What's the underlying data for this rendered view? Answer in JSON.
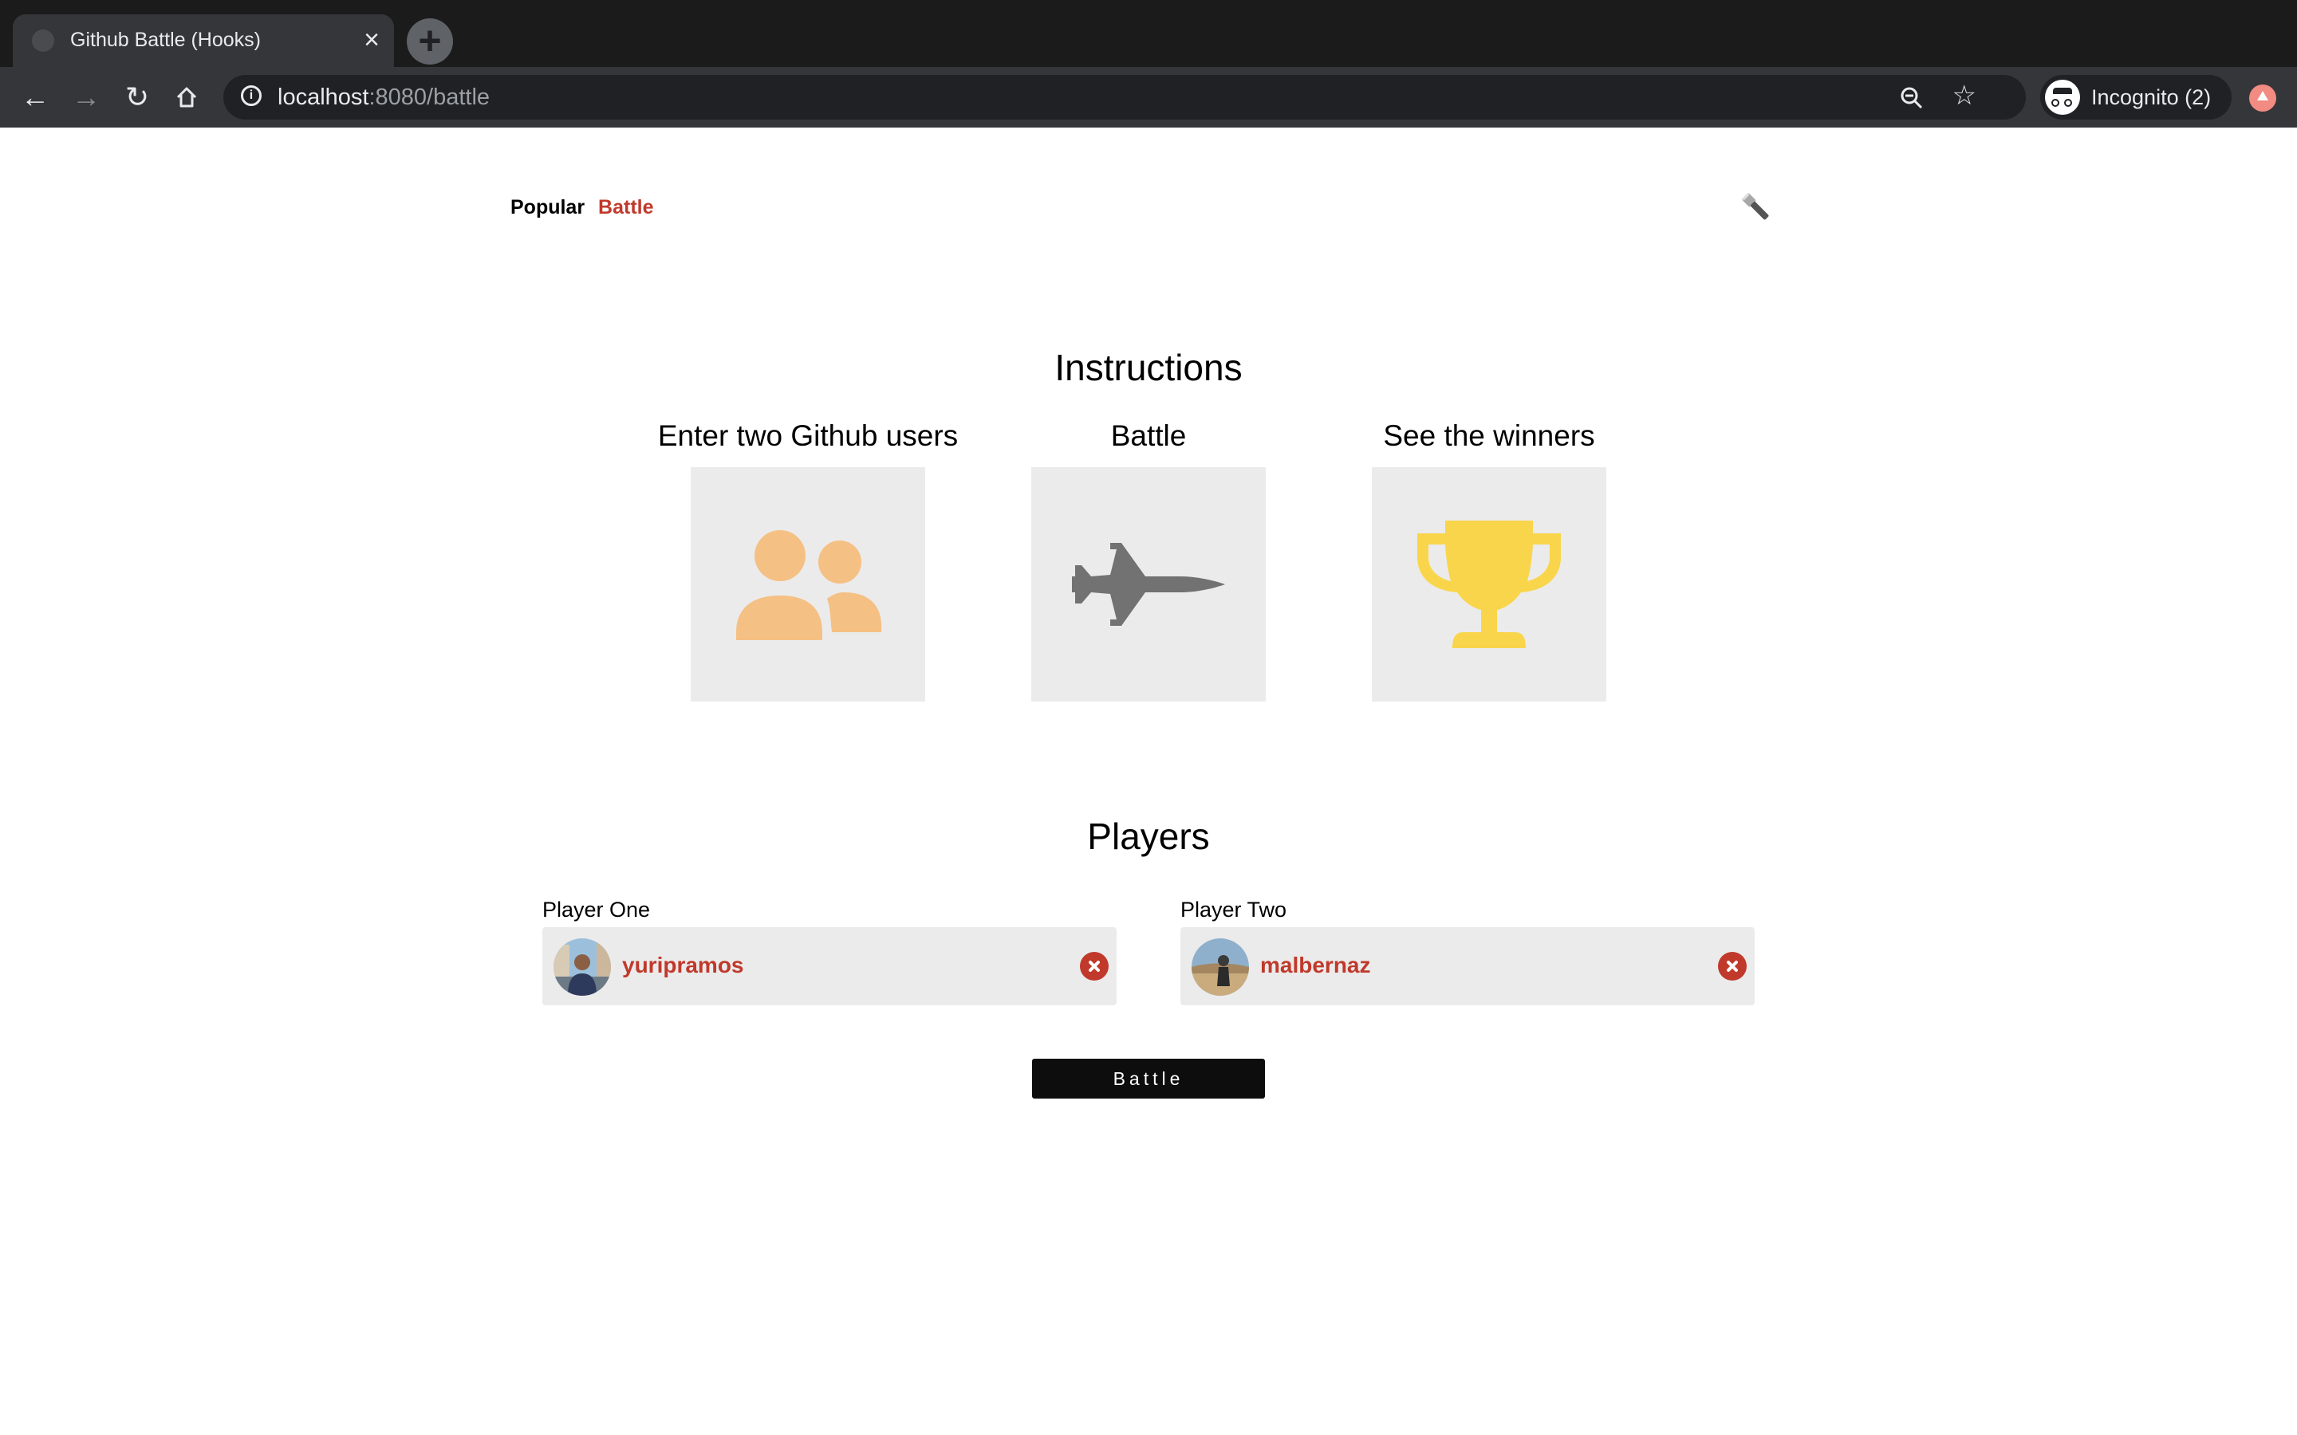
{
  "browser": {
    "tab_title": "Github Battle (Hooks)",
    "tab_close_icon": "close-icon",
    "new_tab_icon": "plus-icon",
    "url_host": "localhost",
    "url_rest": ":8080/battle",
    "incognito_label": "Incognito (2)"
  },
  "nav": {
    "popular": "Popular",
    "battle": "Battle",
    "active": "Battle",
    "active_color": "#c0392b",
    "theme_toggle_icon": "flashlight-icon"
  },
  "instructions": {
    "title": "Instructions",
    "steps": [
      {
        "label": "Enter two Github users",
        "icon": "users-icon",
        "color": "#f5c084"
      },
      {
        "label": "Battle",
        "icon": "fighter-jet-icon",
        "color": "#727272"
      },
      {
        "label": "See the winners",
        "icon": "trophy-icon",
        "color": "#f9d54b"
      }
    ]
  },
  "players": {
    "title": "Players",
    "one": {
      "label": "Player One",
      "username": "yuripramos"
    },
    "two": {
      "label": "Player Two",
      "username": "malbernaz"
    }
  },
  "battle_button": "Battle",
  "colors": {
    "accent": "#c0392b",
    "card_bg": "#ebebeb",
    "button_bg": "#0d0d0d"
  }
}
